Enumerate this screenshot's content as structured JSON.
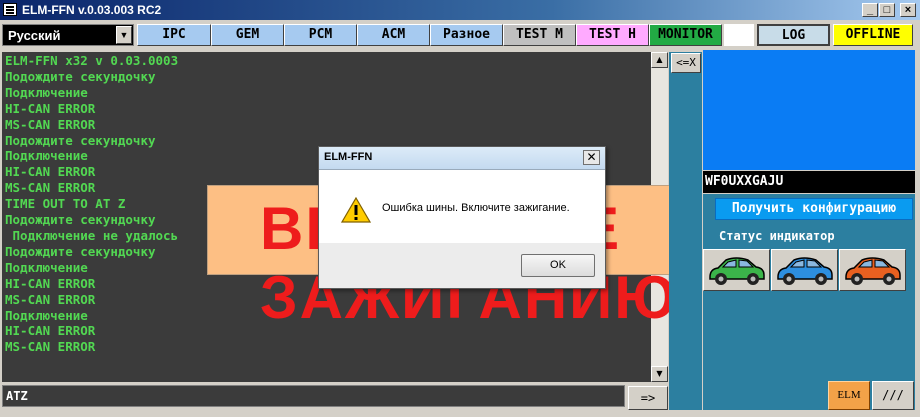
{
  "window": {
    "title": "ELM-FFN  v.0.03.003 RC2",
    "minimize_label": "_",
    "maximize_label": "□",
    "close_label": "×"
  },
  "toolbar": {
    "language": "Русский",
    "tabs": [
      {
        "label": "IPC",
        "color": "#a6caf0"
      },
      {
        "label": "GEM",
        "color": "#a6caf0"
      },
      {
        "label": "PCM",
        "color": "#a6caf0"
      },
      {
        "label": "ACM",
        "color": "#a6caf0"
      },
      {
        "label": "Разное",
        "color": "#a6caf0"
      },
      {
        "label": "TEST M",
        "color": "#c0c0c0"
      },
      {
        "label": "TEST H",
        "color": "#ffaaff"
      },
      {
        "label": "MONITOR",
        "color": "#22aa44"
      }
    ],
    "log_label": "LOG",
    "status_label": "OFFLINE",
    "status_color": "#ffff00"
  },
  "console": {
    "lines": [
      "ELM-FFN x32 v 0.03.0003",
      "Подождите секундочку",
      "Подключение",
      "HI-CAN ERROR",
      "MS-CAN ERROR",
      "Подождите секундочку",
      "Подключение",
      "HI-CAN ERROR",
      "MS-CAN ERROR",
      "TIME OUT TO AT Z",
      "Подождите секундочку",
      " Подключение не удалось",
      "Подождите секундочку",
      "Подключение",
      "HI-CAN ERROR",
      "MS-CAN ERROR",
      "Подключение",
      "HI-CAN ERROR",
      "MS-CAN ERROR"
    ],
    "banner_text": "ВКЛЮЧИТЕ ЗАЖИГАНИЮ",
    "command_value": "ATZ",
    "send_label": "=>",
    "back_label": "<=X"
  },
  "side": {
    "vin": "WF0UXXGAJU",
    "get_config_label": "Получить конфигурацию",
    "status_indicator_label": "Статус индикатор",
    "cars": [
      {
        "name": "green",
        "color": "#3bb44a"
      },
      {
        "name": "blue",
        "color": "#2d8fe0"
      },
      {
        "name": "orange",
        "color": "#e86020"
      }
    ],
    "elm_label": "ELM",
    "slash_label": "///"
  },
  "dialog": {
    "title": "ELM-FFN",
    "close_label": "✕",
    "message": "Ошибка шины. Включите зажигание.",
    "ok_label": "OK"
  }
}
